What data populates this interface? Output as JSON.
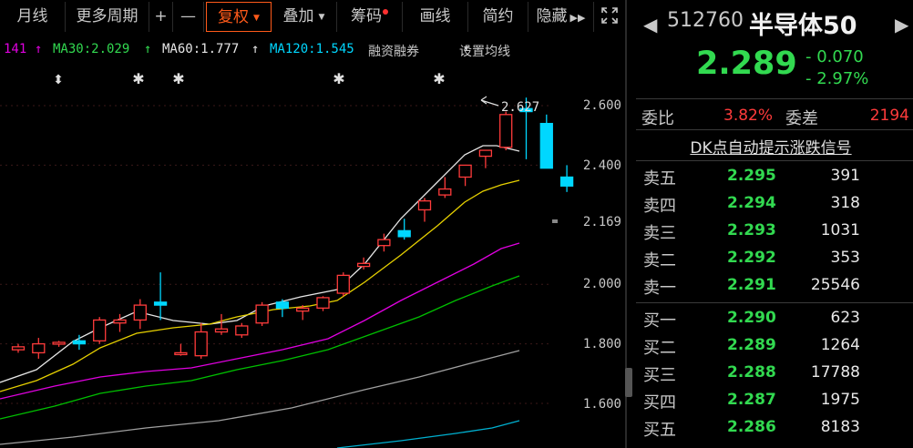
{
  "toolbar": {
    "items": [
      "月线",
      "更多周期",
      "+",
      "—",
      "复权",
      "叠加",
      "筹码",
      "画线",
      "简约",
      "隐藏"
    ]
  },
  "ma_legend": {
    "ma10_value": "141",
    "ma10_arrow": "↑",
    "ma30": "MA30:2.029",
    "ma30_arrow": "↑",
    "ma60": "MA60:1.777",
    "ma60_arrow": "↑",
    "ma120": "MA120:1.545",
    "margin": "融资融券",
    "settings": "设置均线"
  },
  "chart": {
    "y_labels": [
      "2.600",
      "2.400",
      "2.169",
      "2.000",
      "1.800",
      "1.600"
    ],
    "high_marker": "2.627",
    "colors": {
      "up": "#ff3b3b",
      "down": "#00d7ff",
      "ma_white": "#e6e6e6",
      "ma_yellow": "#e6d000",
      "ma_magenta": "#e000e0",
      "ma_green": "#00c000",
      "ma_gray": "#a0a0a0",
      "ma_cyan": "#00b0d0"
    }
  },
  "chart_data": {
    "type": "candlestick",
    "y_axis_ticks": [
      1.6,
      1.8,
      2.0,
      2.169,
      2.4,
      2.6
    ],
    "high_marker": 2.627,
    "candles": [
      {
        "o": 1.78,
        "h": 1.8,
        "l": 1.77,
        "c": 1.79
      },
      {
        "o": 1.77,
        "h": 1.82,
        "l": 1.75,
        "c": 1.8
      },
      {
        "o": 1.8,
        "h": 1.81,
        "l": 1.79,
        "c": 1.805
      },
      {
        "o": 1.81,
        "h": 1.83,
        "l": 1.78,
        "c": 1.8
      },
      {
        "o": 1.81,
        "h": 1.89,
        "l": 1.8,
        "c": 1.88
      },
      {
        "o": 1.87,
        "h": 1.9,
        "l": 1.84,
        "c": 1.88
      },
      {
        "o": 1.88,
        "h": 1.95,
        "l": 1.85,
        "c": 1.93
      },
      {
        "o": 1.94,
        "h": 2.04,
        "l": 1.88,
        "c": 1.93
      },
      {
        "o": 1.77,
        "h": 1.8,
        "l": 1.76,
        "c": 1.77
      },
      {
        "o": 1.76,
        "h": 1.87,
        "l": 1.75,
        "c": 1.84
      },
      {
        "o": 1.84,
        "h": 1.9,
        "l": 1.83,
        "c": 1.85
      },
      {
        "o": 1.83,
        "h": 1.87,
        "l": 1.82,
        "c": 1.86
      },
      {
        "o": 1.87,
        "h": 1.94,
        "l": 1.86,
        "c": 1.93
      },
      {
        "o": 1.94,
        "h": 1.95,
        "l": 1.89,
        "c": 1.92
      },
      {
        "o": 1.91,
        "h": 1.93,
        "l": 1.88,
        "c": 1.92
      },
      {
        "o": 1.92,
        "h": 1.96,
        "l": 1.91,
        "c": 1.955
      },
      {
        "o": 1.97,
        "h": 2.04,
        "l": 1.96,
        "c": 2.03
      },
      {
        "o": 2.06,
        "h": 2.09,
        "l": 2.05,
        "c": 2.07
      },
      {
        "o": 2.13,
        "h": 2.17,
        "l": 2.11,
        "c": 2.15
      },
      {
        "o": 2.18,
        "h": 2.22,
        "l": 2.15,
        "c": 2.16
      },
      {
        "o": 2.25,
        "h": 2.29,
        "l": 2.21,
        "c": 2.28
      },
      {
        "o": 2.3,
        "h": 2.36,
        "l": 2.29,
        "c": 2.32
      },
      {
        "o": 2.36,
        "h": 2.4,
        "l": 2.33,
        "c": 2.4
      },
      {
        "o": 2.43,
        "h": 2.45,
        "l": 2.39,
        "c": 2.45
      },
      {
        "o": 2.46,
        "h": 2.58,
        "l": 2.45,
        "c": 2.57
      },
      {
        "o": 2.59,
        "h": 2.627,
        "l": 2.42,
        "c": 2.58
      },
      {
        "o": 2.54,
        "h": 2.57,
        "l": 2.39,
        "c": 2.39
      },
      {
        "o": 2.36,
        "h": 2.4,
        "l": 2.31,
        "c": 2.33
      }
    ]
  },
  "quote": {
    "code": "512760",
    "name": "半导体50",
    "price": "2.289",
    "change": "- 0.070",
    "change_pct": "- 2.97%",
    "weibi_label": "委比",
    "weibi": "3.82%",
    "weicha_label": "委差",
    "weicha": "2194",
    "dk_text": "DK点自动提示涨跌信号",
    "sell": [
      {
        "label": "卖五",
        "price": "2.295",
        "vol": "391"
      },
      {
        "label": "卖四",
        "price": "2.294",
        "vol": "318"
      },
      {
        "label": "卖三",
        "price": "2.293",
        "vol": "1031"
      },
      {
        "label": "卖二",
        "price": "2.292",
        "vol": "353"
      },
      {
        "label": "卖一",
        "price": "2.291",
        "vol": "25546"
      }
    ],
    "buy": [
      {
        "label": "买一",
        "price": "2.290",
        "vol": "623"
      },
      {
        "label": "买二",
        "price": "2.289",
        "vol": "1264"
      },
      {
        "label": "买三",
        "price": "2.288",
        "vol": "17788"
      },
      {
        "label": "买四",
        "price": "2.287",
        "vol": "1975"
      },
      {
        "label": "买五",
        "price": "2.286",
        "vol": "8183"
      }
    ]
  }
}
